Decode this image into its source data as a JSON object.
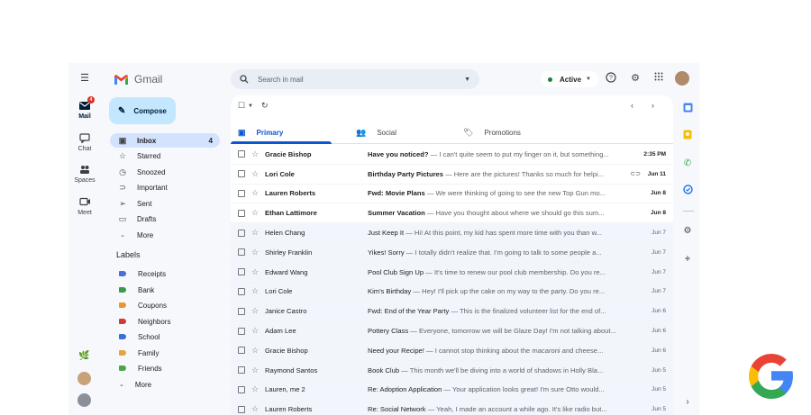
{
  "rail": {
    "mail": {
      "label": "Mail",
      "badge": "4"
    },
    "chat": {
      "label": "Chat"
    },
    "spaces": {
      "label": "Spaces"
    },
    "meet": {
      "label": "Meet"
    }
  },
  "nav": {
    "app_name": "Gmail",
    "compose_label": "Compose",
    "items": [
      {
        "label": "Inbox",
        "count": "4",
        "icon": "inbox-icon"
      },
      {
        "label": "Starred",
        "icon": "star-icon"
      },
      {
        "label": "Snoozed",
        "icon": "clock-icon"
      },
      {
        "label": "Important",
        "icon": "important-icon"
      },
      {
        "label": "Sent",
        "icon": "send-icon"
      },
      {
        "label": "Drafts",
        "icon": "draft-icon"
      },
      {
        "label": "More",
        "icon": "chevron-down-icon"
      }
    ],
    "labels_title": "Labels",
    "labels": [
      {
        "label": "Receipts",
        "color": "#4a6fd8"
      },
      {
        "label": "Bank",
        "color": "#3a9b4a"
      },
      {
        "label": "Coupons",
        "color": "#e8962e"
      },
      {
        "label": "Neighbors",
        "color": "#d23a3a"
      },
      {
        "label": "School",
        "color": "#3a6fd8"
      },
      {
        "label": "Family",
        "color": "#e8a33a"
      },
      {
        "label": "Friends",
        "color": "#4aa84a"
      }
    ],
    "labels_more": "More"
  },
  "search": {
    "placeholder": "Search in mail"
  },
  "status": {
    "label": "Active"
  },
  "tabs": [
    {
      "label": "Primary",
      "icon": "inbox-icon"
    },
    {
      "label": "Social",
      "icon": "people-icon"
    },
    {
      "label": "Promotions",
      "icon": "tag-icon"
    }
  ],
  "emails": [
    {
      "sender": "Gracie Bishop",
      "subject": "Have you noticed?",
      "snippet": " — I can't quite seem to put my finger on it, but something...",
      "date": "2:35 PM",
      "unread": true,
      "attachment": false
    },
    {
      "sender": "Lori Cole",
      "subject": "Birthday Party Pictures",
      "snippet": " — Here are the pictures! Thanks so much for helpi...",
      "date": "Jun 11",
      "unread": true,
      "attachment": true
    },
    {
      "sender": "Lauren Roberts",
      "subject": "Fwd: Movie Plans",
      "snippet": " — We were thinking of going to see the new Top Gun mo...",
      "date": "Jun 8",
      "unread": true,
      "attachment": false
    },
    {
      "sender": "Ethan Lattimore",
      "subject": "Summer Vacation",
      "snippet": " — Have you thought about where we should go this sum...",
      "date": "Jun 8",
      "unread": true,
      "attachment": false
    },
    {
      "sender": "Helen Chang",
      "subject": "Just Keep It",
      "snippet": " — Hi! At this point, my kid has spent more time with you than w...",
      "date": "Jun 7",
      "unread": false,
      "attachment": false
    },
    {
      "sender": "Shirley Franklin",
      "subject": "Yikes! Sorry",
      "snippet": " — I totally didn't realize that. I'm going to talk to some people a...",
      "date": "Jun 7",
      "unread": false,
      "attachment": false
    },
    {
      "sender": "Edward Wang",
      "subject": "Pool Club Sign Up",
      "snippet": " — It's time to renew our pool club membership. Do you re...",
      "date": "Jun 7",
      "unread": false,
      "attachment": false
    },
    {
      "sender": "Lori Cole",
      "subject": "Kim's Birthday",
      "snippet": " — Hey! I'll pick up the cake on my way to the party. Do you re...",
      "date": "Jun 7",
      "unread": false,
      "attachment": false
    },
    {
      "sender": "Janice Castro",
      "subject": "Fwd: End of the Year Party",
      "snippet": " — This is the finalized volunteer list for the end of...",
      "date": "Jun 6",
      "unread": false,
      "attachment": false
    },
    {
      "sender": "Adam Lee",
      "subject": "Pottery Class",
      "snippet": " — Everyone, tomorrow we will be Glaze Day! I'm not talking about...",
      "date": "Jun 6",
      "unread": false,
      "attachment": false
    },
    {
      "sender": "Gracie Bishop",
      "subject": "Need your Recipe!",
      "snippet": " — I cannot stop thinking about the macaroni and cheese...",
      "date": "Jun 6",
      "unread": false,
      "attachment": false
    },
    {
      "sender": "Raymond Santos",
      "subject": "Book Club",
      "snippet": " — This month we'll be diving into a world of shadows in Holly Bla...",
      "date": "Jun 5",
      "unread": false,
      "attachment": false
    },
    {
      "sender": "Lauren, me 2",
      "subject": "Re: Adoption Application",
      "snippet": " — Your application looks great! I'm sure Otto would...",
      "date": "Jun 5",
      "unread": false,
      "attachment": false
    },
    {
      "sender": "Lauren Roberts",
      "subject": "Re: Social Network",
      "snippet": " — Yeah, I made an account a while ago. It's like radio but...",
      "date": "Jun 5",
      "unread": false,
      "attachment": false
    }
  ]
}
